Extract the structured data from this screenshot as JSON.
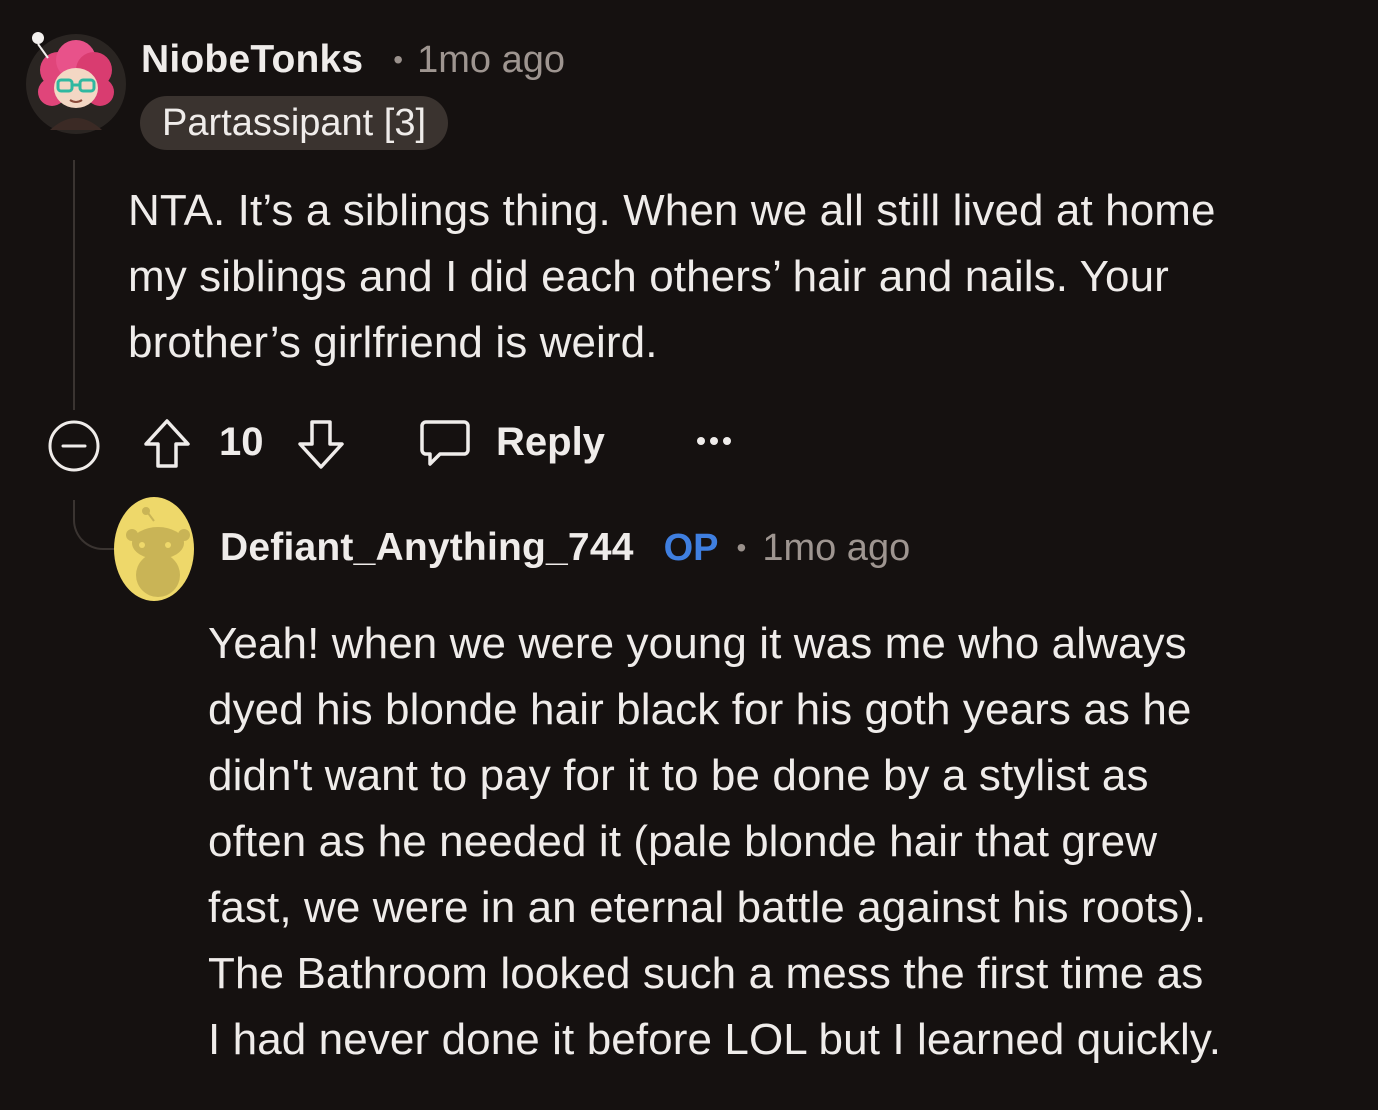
{
  "comment": {
    "username": "NiobeTonks",
    "separator": "•",
    "time": "1mo ago",
    "flair": "Partassipant [3]",
    "body_lines": [
      "NTA. It’s a siblings thing. When we all still lived at home",
      "my siblings and I did each others’ hair and nails. Your",
      "brother’s girlfriend is weird."
    ],
    "votes": "10",
    "reply_label": "Reply",
    "more_label": "•••"
  },
  "reply": {
    "username": "Defiant_Anything_744",
    "op_badge": "OP",
    "separator": "•",
    "time": "1mo ago",
    "body_lines": [
      "Yeah! when we were young it was me who always",
      "dyed his blonde hair black for his goth years as he",
      "didn't want to pay for it to be done by a stylist as",
      "often as he needed it (pale blonde hair that grew",
      "fast, we were in an eternal battle against his roots).",
      "The Bathroom looked such a mess the first time as",
      "I had never done it before LOL but I learned quickly."
    ]
  },
  "colors": {
    "background": "#151110",
    "text": "#efecea",
    "muted": "#9e9590",
    "op_blue": "#3f7fe0",
    "flair_bg": "#3a332f",
    "thread_line": "#3a3431",
    "snoo_yellow": "#eed86a"
  },
  "icons": {
    "collapse": "minus-circle-icon",
    "upvote": "arrow-up-icon",
    "downvote": "arrow-down-icon",
    "reply": "speech-bubble-icon",
    "more": "ellipsis-icon"
  }
}
